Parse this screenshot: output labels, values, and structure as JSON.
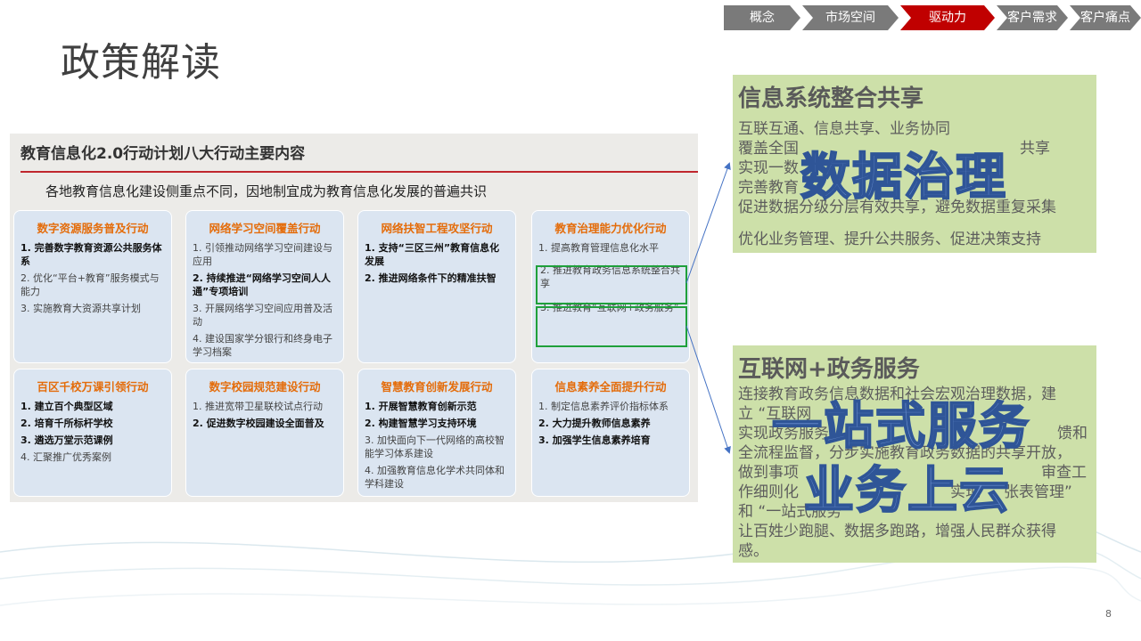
{
  "nav": {
    "crumbs": [
      {
        "label": "概念"
      },
      {
        "label": "市场空间"
      },
      {
        "label": "驱动力"
      },
      {
        "label": "客户需求"
      },
      {
        "label": "客户痛点"
      }
    ],
    "active_color": "#c00000",
    "inactive_color": "#7a7a7a"
  },
  "page_title": "政策解读",
  "panel": {
    "title": "教育信息化2.0行动计划八大行动主要内容",
    "subtitle": "各地教育信息化建设侧重点不同，因地制宜成为教育信息化发展的普遍共识",
    "cards": [
      {
        "title": "数字资源服务普及行动",
        "items": [
          {
            "text": "1. 完善数字教育资源公共服务体系",
            "bold": true
          },
          {
            "text": "2. 优化“平台+教育”服务模式与能力",
            "bold": false
          },
          {
            "text": "3. 实施教育大资源共享计划",
            "bold": false
          }
        ]
      },
      {
        "title": "网络学习空间覆盖行动",
        "items": [
          {
            "text": "1. 引领推动网络学习空间建设与应用",
            "bold": false
          },
          {
            "text": "2. 持续推进“网络学习空间人人通”专项培训",
            "bold": true
          },
          {
            "text": "3. 开展网络学习空间应用普及活动",
            "bold": false
          },
          {
            "text": "4. 建设国家学分银行和终身电子学习档案",
            "bold": false
          }
        ]
      },
      {
        "title": "网络扶智工程攻坚行动",
        "items": [
          {
            "text": "1. 支持“三区三州”教育信息化发展",
            "bold": true
          },
          {
            "text": "2. 推进网络条件下的精准扶智",
            "bold": true
          }
        ]
      },
      {
        "title": "教育治理能力优化行动",
        "items": [
          {
            "text": "1. 提高教育管理信息化水平",
            "bold": false
          },
          {
            "text": "2. 推进教育政务信息系统整合共享",
            "bold": false
          },
          {
            "text": "3. 推进教育“互联网+政务服务”",
            "bold": false
          }
        ]
      },
      {
        "title": "百区千校万课引领行动",
        "items": [
          {
            "text": "1. 建立百个典型区域",
            "bold": true
          },
          {
            "text": "2. 培育千所标杆学校",
            "bold": true
          },
          {
            "text": "3. 遴选万堂示范课例",
            "bold": true
          },
          {
            "text": "4. 汇聚推广优秀案例",
            "bold": false
          }
        ]
      },
      {
        "title": "数字校园规范建设行动",
        "items": [
          {
            "text": "1. 推进宽带卫星联校试点行动",
            "bold": false
          },
          {
            "text": "2. 促进数字校园建设全面普及",
            "bold": true
          }
        ]
      },
      {
        "title": "智慧教育创新发展行动",
        "items": [
          {
            "text": "1. 开展智慧教育创新示范",
            "bold": true
          },
          {
            "text": "2. 构建智慧学习支持环境",
            "bold": true
          },
          {
            "text": "3. 加快面向下一代网络的高校智能学习体系建设",
            "bold": false
          },
          {
            "text": "4. 加强教育信息化学术共同体和学科建设",
            "bold": false
          }
        ]
      },
      {
        "title": "信息素养全面提升行动",
        "items": [
          {
            "text": "1. 制定信息素养评价指标体系",
            "bold": false
          },
          {
            "text": "2. 大力提升教师信息素养",
            "bold": true
          },
          {
            "text": "3. 加强学生信息素养培育",
            "bold": true
          }
        ]
      }
    ]
  },
  "box1": {
    "title": "信息系统整合共享",
    "lines": [
      "互联互通、信息共享、业务协同",
      "覆盖全国",
      "共享",
      "实现一数",
      "完善教育",
      "促进数据分级分层有效共享，避免数据重复采集",
      "优化业务管理、提升公共服务、促进决策支持"
    ],
    "overlay": "数据治理"
  },
  "box2": {
    "title": "互联网+政务服务",
    "lines": [
      "连接教育政务信息数据和社会宏观治理数据，建",
      "立 “互联网",
      "实现政务服务",
      "馈和",
      "全流程监督，分步实施教育政务数据的共享开放，",
      "做到事项",
      "审查工",
      "作细则化",
      "实现",
      "张表管理”",
      "和 “一站式服务”",
      "让百姓少跑腿、数据多跑路，增强人民群众获得",
      "感。"
    ],
    "overlay_1": "一站式服务",
    "overlay_2": "业务上云"
  },
  "page_number": "8"
}
